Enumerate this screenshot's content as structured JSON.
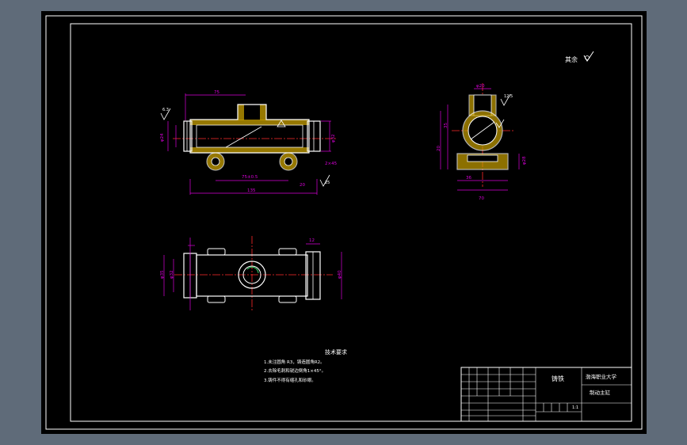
{
  "colors": {
    "viewport_bg": "#5f6b79",
    "sheet_bg": "#000000",
    "frame": "#ffffff",
    "outline": "#ffffff",
    "dimension": "#d800d8",
    "center_line": "#ff2a2a",
    "hatch": "#c8a000",
    "cyan": "#35d7ff",
    "green": "#39d86b"
  },
  "drawing": {
    "roughness_note": "其余",
    "title_company": "渤海职业大学",
    "title_part_name": "制动主缸",
    "title_material": "铸铁",
    "scale": "1:1",
    "tech_req_title": "技术要求",
    "tech_req_lines": [
      "1.未注圆角 R3，铸造圆角R2。",
      "2.去除毛刺和锐边倒角1×45°。",
      "3.铸件不得有缩孔和砂眼。"
    ],
    "dims_front": [
      "75",
      "135",
      "75±0.5",
      "20",
      "2×45",
      "φ24",
      "φ32"
    ],
    "dims_side": [
      "φ20",
      "35",
      "20",
      "φ28",
      "36",
      "70"
    ],
    "dims_top": [
      "φ35",
      "φ32",
      "φ40",
      "12"
    ],
    "roughness_values": [
      "6.3",
      "12.5",
      "25"
    ]
  }
}
